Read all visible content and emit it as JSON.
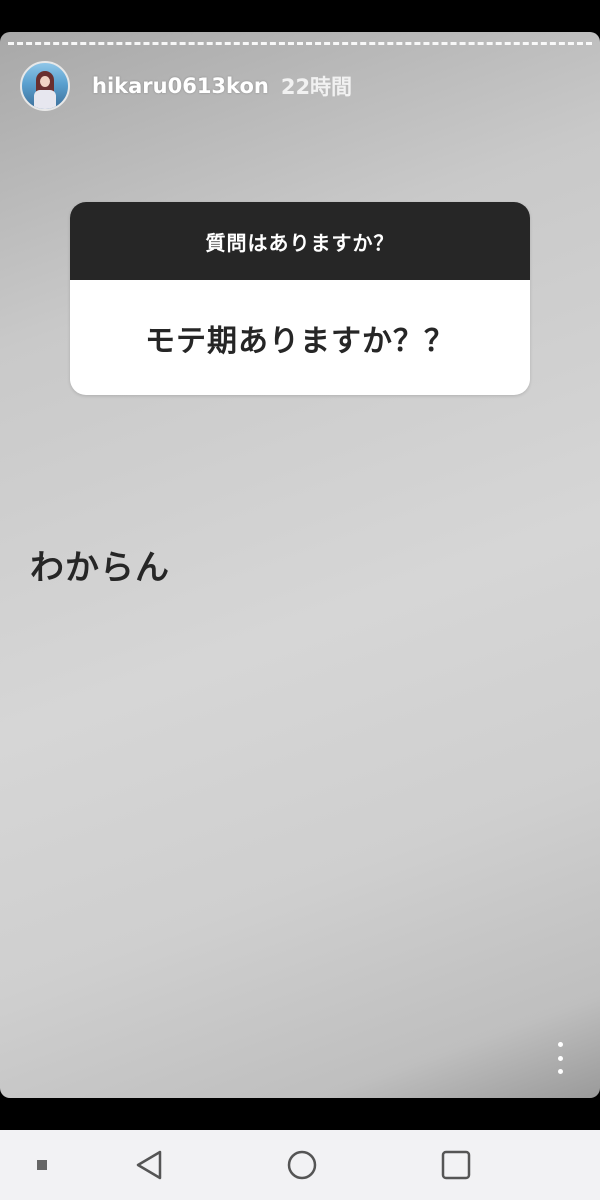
{
  "story": {
    "username": "hikaru0613kon",
    "time": "22時間",
    "question_header": "質問はありますか？",
    "question_text": "モテ期ありますか？？",
    "answer_text": "わからん"
  },
  "icons": {
    "avatar": "profile-avatar",
    "more": "more-vertical-icon",
    "nav_menu": "square-small-icon",
    "nav_back": "triangle-back-icon",
    "nav_home": "circle-home-icon",
    "nav_recents": "square-recents-icon"
  },
  "colors": {
    "question_header_bg": "#262626",
    "question_body_bg": "#ffffff",
    "text_dark": "#262626",
    "nav_bg": "#f2f2f4"
  }
}
